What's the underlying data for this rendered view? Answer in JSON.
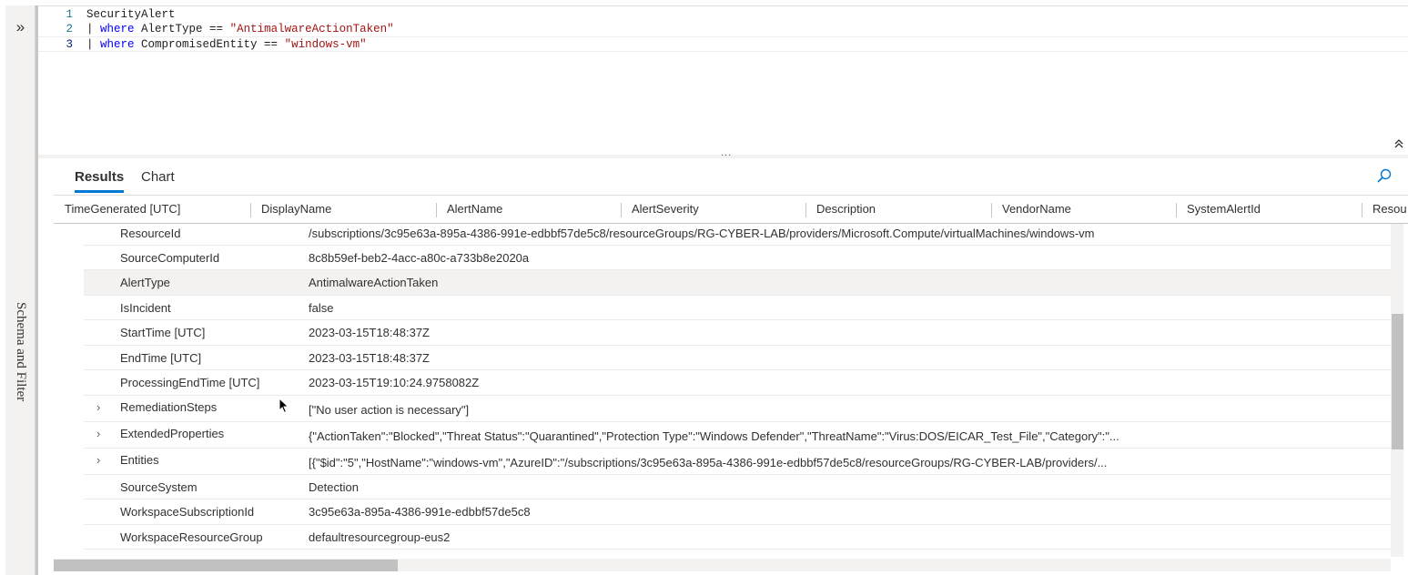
{
  "rail": {
    "expand_glyph": "»",
    "label": "Schema and Filter"
  },
  "editor": {
    "lines": [
      {
        "num": "1",
        "segments": [
          {
            "t": "SecurityAlert",
            "c": "plain"
          }
        ]
      },
      {
        "num": "2",
        "segments": [
          {
            "t": "| ",
            "c": "pipe"
          },
          {
            "t": "where",
            "c": "kw"
          },
          {
            "t": " AlertType == ",
            "c": "plain"
          },
          {
            "t": "\"AntimalwareActionTaken\"",
            "c": "str"
          }
        ]
      },
      {
        "num": "3",
        "segments": [
          {
            "t": "| ",
            "c": "pipe"
          },
          {
            "t": "where",
            "c": "kw"
          },
          {
            "t": " CompromisedEntity == ",
            "c": "plain"
          },
          {
            "t": "\"windows-vm\"",
            "c": "str"
          }
        ]
      }
    ],
    "collapse_glyph": "⌃",
    "splitter_dots": "..."
  },
  "tabs": {
    "results": "Results",
    "chart": "Chart"
  },
  "columns": [
    "TimeGenerated [UTC]",
    "DisplayName",
    "AlertName",
    "AlertSeverity",
    "Description",
    "VendorName",
    "SystemAlertId",
    "Resou"
  ],
  "rows": [
    {
      "key": "ResourceId",
      "value": "/subscriptions/3c95e63a-895a-4386-991e-edbbf57de5c8/resourceGroups/RG-CYBER-LAB/providers/Microsoft.Compute/virtualMachines/windows-vm",
      "expandable": false
    },
    {
      "key": "SourceComputerId",
      "value": "8c8b59ef-beb2-4acc-a80c-a733b8e2020a",
      "expandable": false
    },
    {
      "key": "AlertType",
      "value": "AntimalwareActionTaken",
      "expandable": false,
      "highlighted": true
    },
    {
      "key": "IsIncident",
      "value": "false",
      "expandable": false
    },
    {
      "key": "StartTime [UTC]",
      "value": "2023-03-15T18:48:37Z",
      "expandable": false
    },
    {
      "key": "EndTime [UTC]",
      "value": "2023-03-15T18:48:37Z",
      "expandable": false
    },
    {
      "key": "ProcessingEndTime [UTC]",
      "value": "2023-03-15T19:10:24.9758082Z",
      "expandable": false
    },
    {
      "key": "RemediationSteps",
      "value": "[\"No user action is necessary\"]",
      "expandable": true
    },
    {
      "key": "ExtendedProperties",
      "value": "{\"ActionTaken\":\"Blocked\",\"Threat Status\":\"Quarantined\",\"Protection Type\":\"Windows Defender\",\"ThreatName\":\"Virus:DOS/EICAR_Test_File\",\"Category\":\"...",
      "expandable": true
    },
    {
      "key": "Entities",
      "value": "[{\"$id\":\"5\",\"HostName\":\"windows-vm\",\"AzureID\":\"/subscriptions/3c95e63a-895a-4386-991e-edbbf57de5c8/resourceGroups/RG-CYBER-LAB/providers/...",
      "expandable": true
    },
    {
      "key": "SourceSystem",
      "value": "Detection",
      "expandable": false
    },
    {
      "key": "WorkspaceSubscriptionId",
      "value": "3c95e63a-895a-4386-991e-edbbf57de5c8",
      "expandable": false
    },
    {
      "key": "WorkspaceResourceGroup",
      "value": "defaultresourcegroup-eus2",
      "expandable": false
    }
  ],
  "icons": {
    "search": "search-icon",
    "chevron": "chevron-right-icon"
  },
  "colors": {
    "accent": "#0078d4",
    "keyword": "#0000ff",
    "string": "#a31515"
  }
}
